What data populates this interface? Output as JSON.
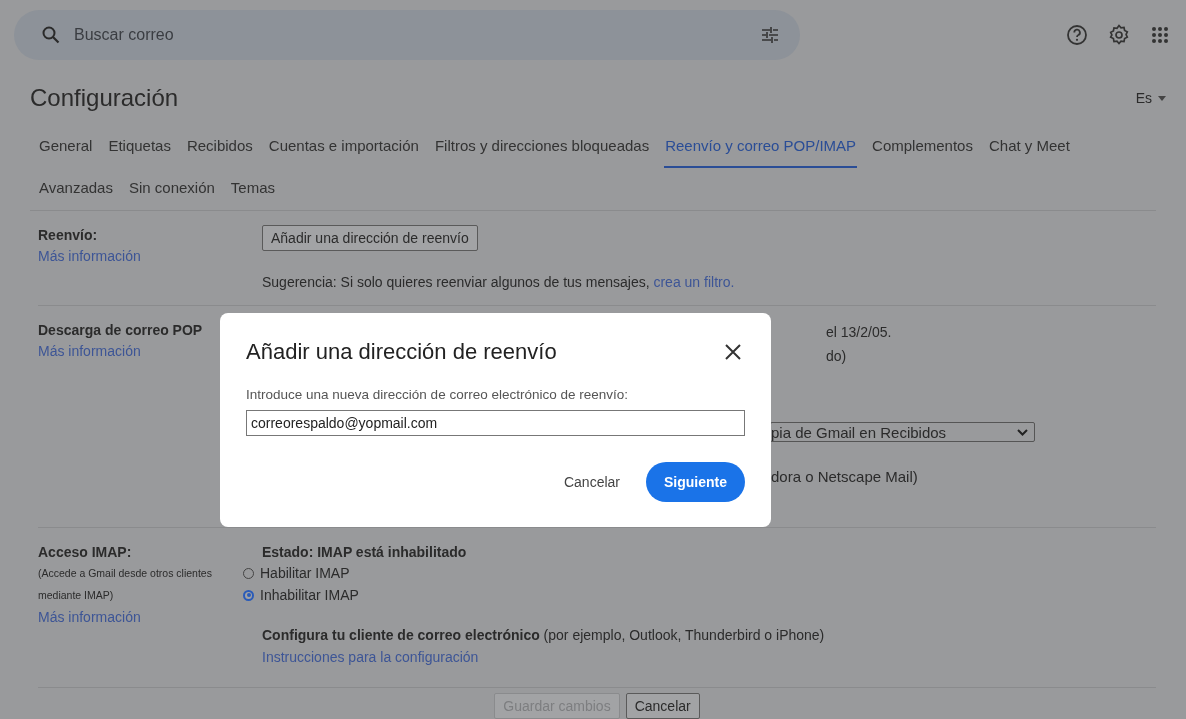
{
  "search": {
    "placeholder": "Buscar correo"
  },
  "header": {
    "title": "Configuración",
    "language": "Es"
  },
  "tabs": [
    {
      "label": "General",
      "selected": false
    },
    {
      "label": "Etiquetas",
      "selected": false
    },
    {
      "label": "Recibidos",
      "selected": false
    },
    {
      "label": "Cuentas e importación",
      "selected": false
    },
    {
      "label": "Filtros y direcciones bloqueadas",
      "selected": false
    },
    {
      "label": "Reenvío y correo POP/IMAP",
      "selected": true
    },
    {
      "label": "Complementos",
      "selected": false
    },
    {
      "label": "Chat y Meet",
      "selected": false
    },
    {
      "label": "Avanzadas",
      "selected": false
    },
    {
      "label": "Sin conexión",
      "selected": false
    },
    {
      "label": "Temas",
      "selected": false
    }
  ],
  "forwarding": {
    "label": "Reenvío:",
    "link": "Más información",
    "button": "Añadir una dirección de reenvío",
    "tip": "Sugerencia: Si solo quieres reenviar algunos de tus mensajes, ",
    "tip_link": "crea un filtro."
  },
  "pop": {
    "label": "Descarga de correo POP",
    "link": "Más información",
    "lines": [
      "el 13/2/05.",
      "do)"
    ],
    "select": "pia de Gmail en Recibidos",
    "note": "dora o Netscape Mail)"
  },
  "imap": {
    "label": "Acceso IMAP:",
    "notes": [
      "(Accede a Gmail desde otros clientes",
      "mediante IMAP)"
    ],
    "link": "Más información",
    "status": "Estado: IMAP está inhabilitado",
    "options": [
      {
        "label": "Habilitar IMAP",
        "selected": false
      },
      {
        "label": "Inhabilitar IMAP",
        "selected": true
      }
    ],
    "configure": "**Configura tu cliente de correo electrónico** (por ejemplo, Outlook, Thunderbird o iPhone)",
    "configure_link": "Instrucciones para la configuración"
  },
  "footer": {
    "save": {
      "label": "Guardar cambios",
      "disabled": true
    },
    "cancel": "Cancelar"
  },
  "dialog": {
    "title": "Añadir una dirección de reenvío",
    "prompt": "Introduce una nueva dirección de correo electrónico de reenvío:",
    "value": "correorespaldo@yopmail.com",
    "cancel": "Cancelar",
    "submit": "Siguiente"
  }
}
